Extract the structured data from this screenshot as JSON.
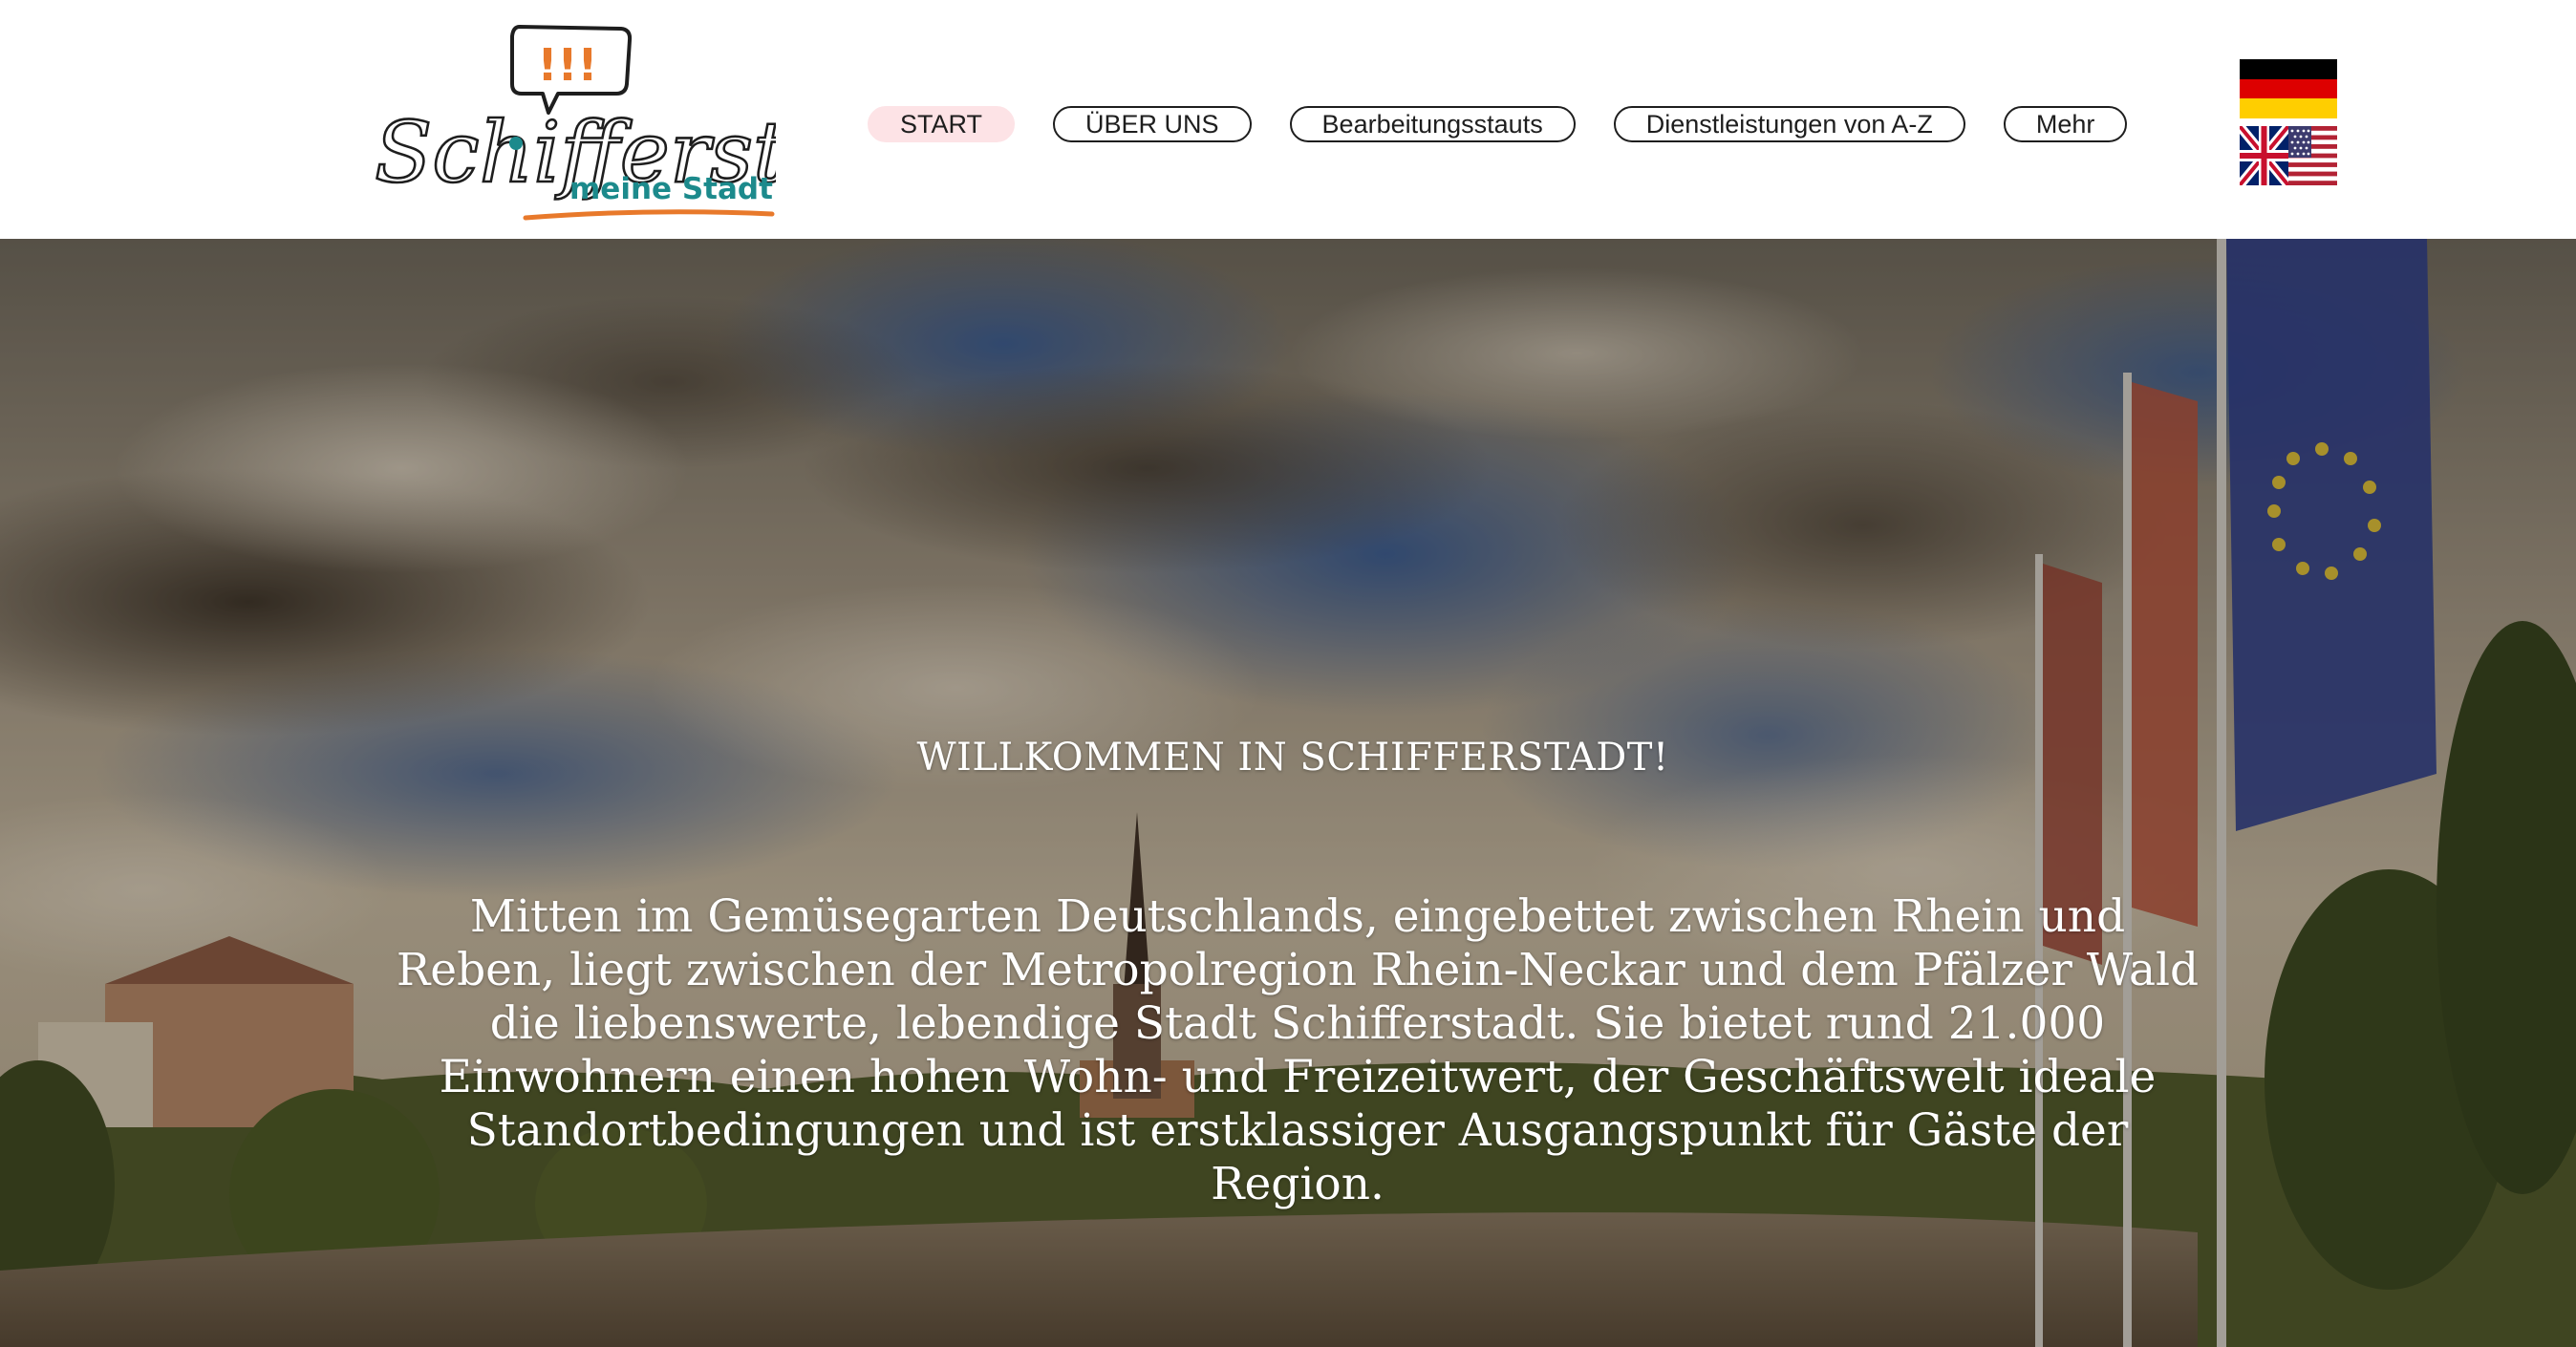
{
  "header": {
    "logo": {
      "script_text": "Schifferstadt",
      "tagline": "meine Stadt!",
      "badge_text": "!!!"
    },
    "nav": [
      {
        "label": "START",
        "active": true
      },
      {
        "label": "ÜBER UNS",
        "active": false
      },
      {
        "label": "Bearbeitungsstauts",
        "active": false
      },
      {
        "label": "Dienstleistungen von A-Z",
        "active": false
      },
      {
        "label": "Mehr",
        "active": false
      }
    ],
    "languages": [
      {
        "icon": "german-flag-icon"
      },
      {
        "icon": "uk-us-flag-icon"
      }
    ]
  },
  "hero": {
    "title": "WILLKOMMEN IN SCHIFFERSTADT!",
    "text": "Mitten im Gemüsegarten Deutschlands, eingebettet zwischen Rhein und Reben, liegt zwischen der Metropolregion Rhein-Neckar und dem Pfälzer Wald die liebenswerte, lebendige Stadt Schifferstadt. Sie bietet rund 21.000 Einwohnern einen hohen Wohn- und Freizeitwert, der Geschäftswelt ideale Standortbedingungen und ist erstklassiger Ausgangspunkt für Gäste der Region."
  },
  "colors": {
    "accent_orange": "#e8792b",
    "accent_teal": "#1c8a8c",
    "nav_active_bg": "#fde3e6",
    "text_dark": "#1e1e1e"
  }
}
